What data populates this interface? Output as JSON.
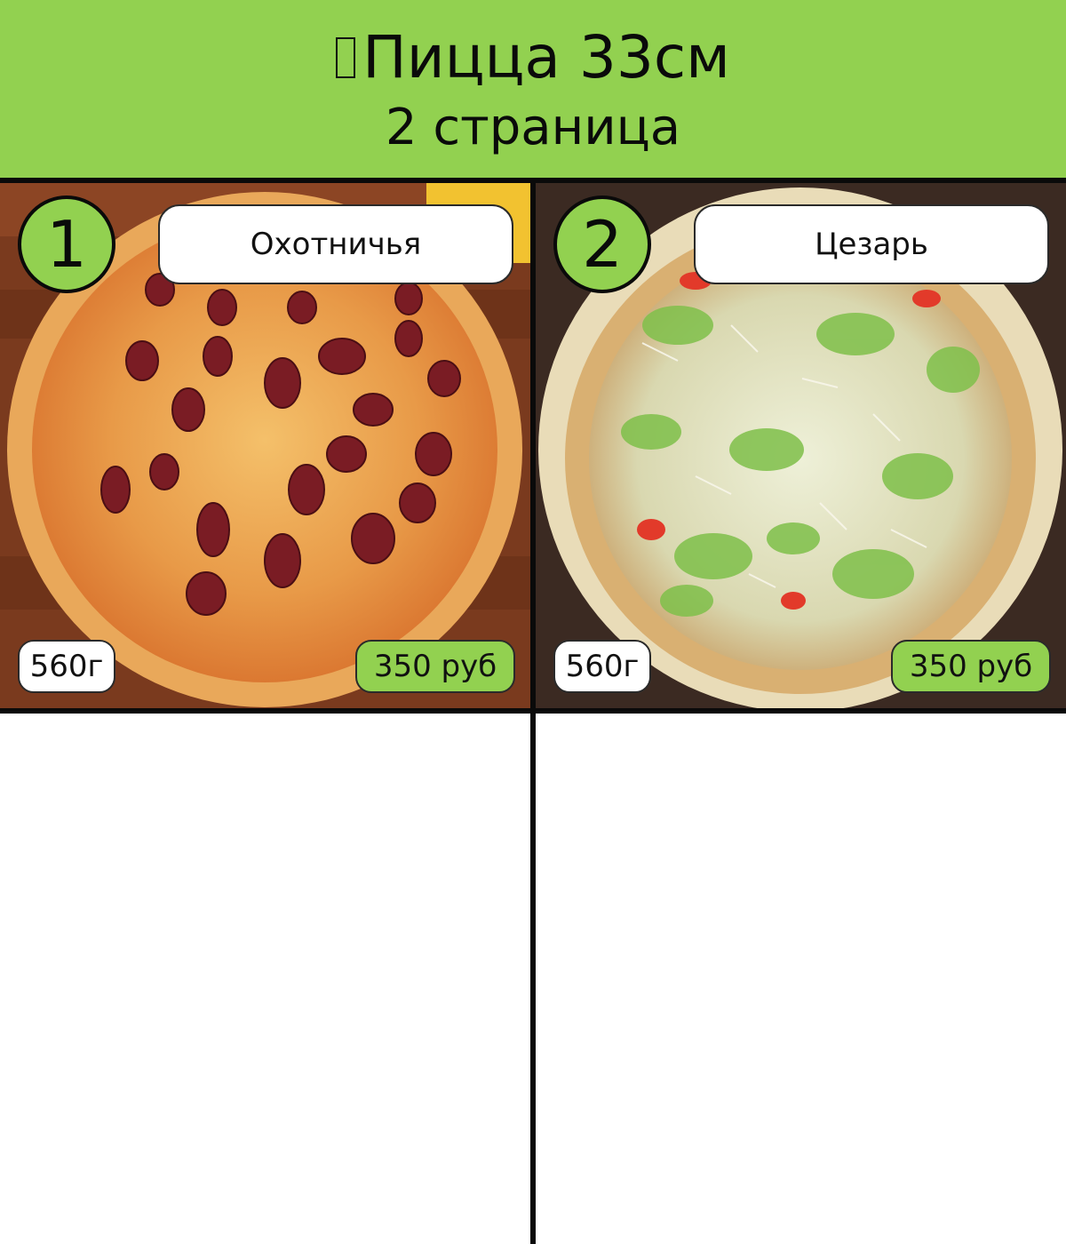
{
  "header": {
    "title": "Пицца 33см",
    "subtitle": "2 страница",
    "title_icon": "missing-glyph-icon"
  },
  "colors": {
    "accent_green": "#92d150",
    "grid_lines": "#0a0a0a",
    "background": "#ffffff"
  },
  "items": [
    {
      "number": "1",
      "name": "Охотничья",
      "weight": "560г",
      "price": "350 руб",
      "photo": "pizza-hunter-photo"
    },
    {
      "number": "2",
      "name": "Цезарь",
      "weight": "560г",
      "price": "350 руб",
      "photo": "pizza-caesar-photo"
    }
  ]
}
